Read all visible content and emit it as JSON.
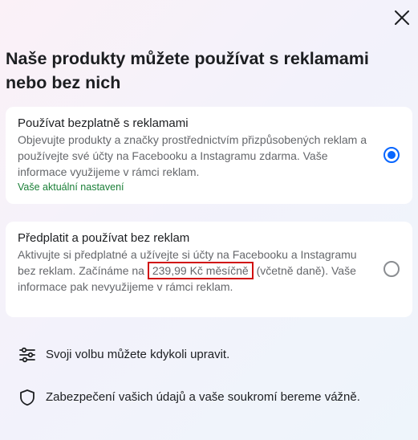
{
  "dialog": {
    "title": "Naše produkty můžete používat s reklamami nebo bez nich",
    "close_icon": "close-icon"
  },
  "options": {
    "free": {
      "title": "Používat bezplatně s reklamami",
      "description": "Objevujte produkty a značky prostřednictvím přizpůsobených reklam a používejte své účty na Facebooku a Instagramu zdarma. Vaše informace využijeme v rámci reklam.",
      "status": "Vaše aktuální nastavení",
      "selected": true
    },
    "subscribe": {
      "title": "Předplatit a používat bez reklam",
      "description_before": "Aktivujte si předplatné a užívejte si účty na Facebooku a Instagramu bez reklam. Začínáme na ",
      "price": "239,99 Kč měsíčně",
      "description_after": " (včetně daně). Vaše informace pak nevyužijeme v rámci reklam.",
      "selected": false
    }
  },
  "info": {
    "settings_text": "Svoji volbu můžete kdykoli upravit.",
    "settings_icon": "sliders-icon",
    "privacy_text": "Zabezpečení vašich údajů a vaše soukromí bereme vážně.",
    "privacy_icon": "shield-icon"
  },
  "colors": {
    "accent": "#0866ff",
    "status_green": "#1a7f37",
    "highlight_red": "#d10f0f"
  }
}
